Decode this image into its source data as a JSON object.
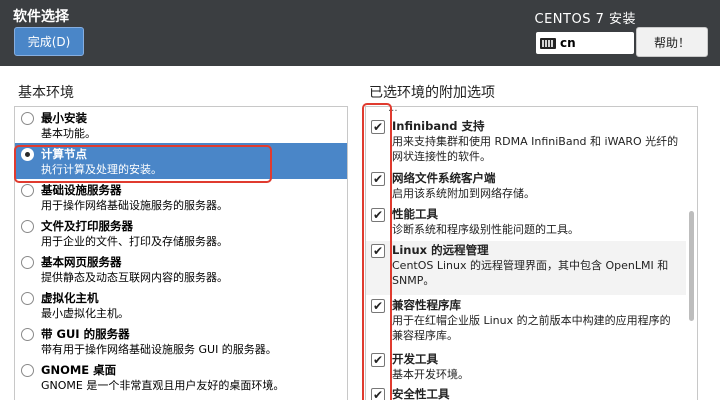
{
  "header": {
    "page_title": "软件选择",
    "done_label": "完成(D)",
    "product_title": "CENTOS 7 安装",
    "keyboard_layout": "cn",
    "help_label": "帮助！"
  },
  "left": {
    "heading": "基本环境",
    "items": [
      {
        "name": "最小安装",
        "desc": "基本功能。"
      },
      {
        "name": "计算节点",
        "desc": "执行计算及处理的安装。"
      },
      {
        "name": "基础设施服务器",
        "desc": "用于操作网络基础设施服务的服务器。"
      },
      {
        "name": "文件及打印服务器",
        "desc": "用于企业的文件、打印及存储服务器。"
      },
      {
        "name": "基本网页服务器",
        "desc": "提供静态及动态互联网内容的服务器。"
      },
      {
        "name": "虚拟化主机",
        "desc": "最小虚拟化主机。"
      },
      {
        "name": "带 GUI 的服务器",
        "desc": "带有用于操作网络基础设施服务 GUI 的服务器。"
      },
      {
        "name": "GNOME 桌面",
        "desc": "GNOME 是一个非常直观且用户友好的桌面环境。"
      }
    ],
    "selected_index": 1
  },
  "right": {
    "heading": "已选环境的附加选项",
    "clipped_text": "...",
    "items": [
      {
        "name": "Infiniband 支持",
        "desc1": "用来支持集群和使用 RDMA InfiniBand 和 iWARO 光纤的",
        "desc2": "网状连接性的软件。",
        "checked": true
      },
      {
        "name": "网络文件系统客户端",
        "desc1": "启用该系统附加到网络存储。",
        "desc2": "",
        "checked": true
      },
      {
        "name": "性能工具",
        "desc1": "诊断系统和程序级别性能问题的工具。",
        "desc2": "",
        "checked": true
      },
      {
        "name": "Linux 的远程管理",
        "desc1": "CentOS Linux 的远程管理界面，其中包含 OpenLMI 和",
        "desc2": "SNMP。",
        "checked": true
      },
      {
        "name": "兼容性程序库",
        "desc1": "用于在红帽企业版 Linux 的之前版本中构建的应用程序的",
        "desc2": "兼容程序库。",
        "checked": true
      },
      {
        "name": "开发工具",
        "desc1": "基本开发环境。",
        "desc2": "",
        "checked": true
      },
      {
        "name": "安全性工具",
        "desc1": "",
        "desc2": "",
        "checked": true
      }
    ],
    "check_glyph": "✔"
  }
}
